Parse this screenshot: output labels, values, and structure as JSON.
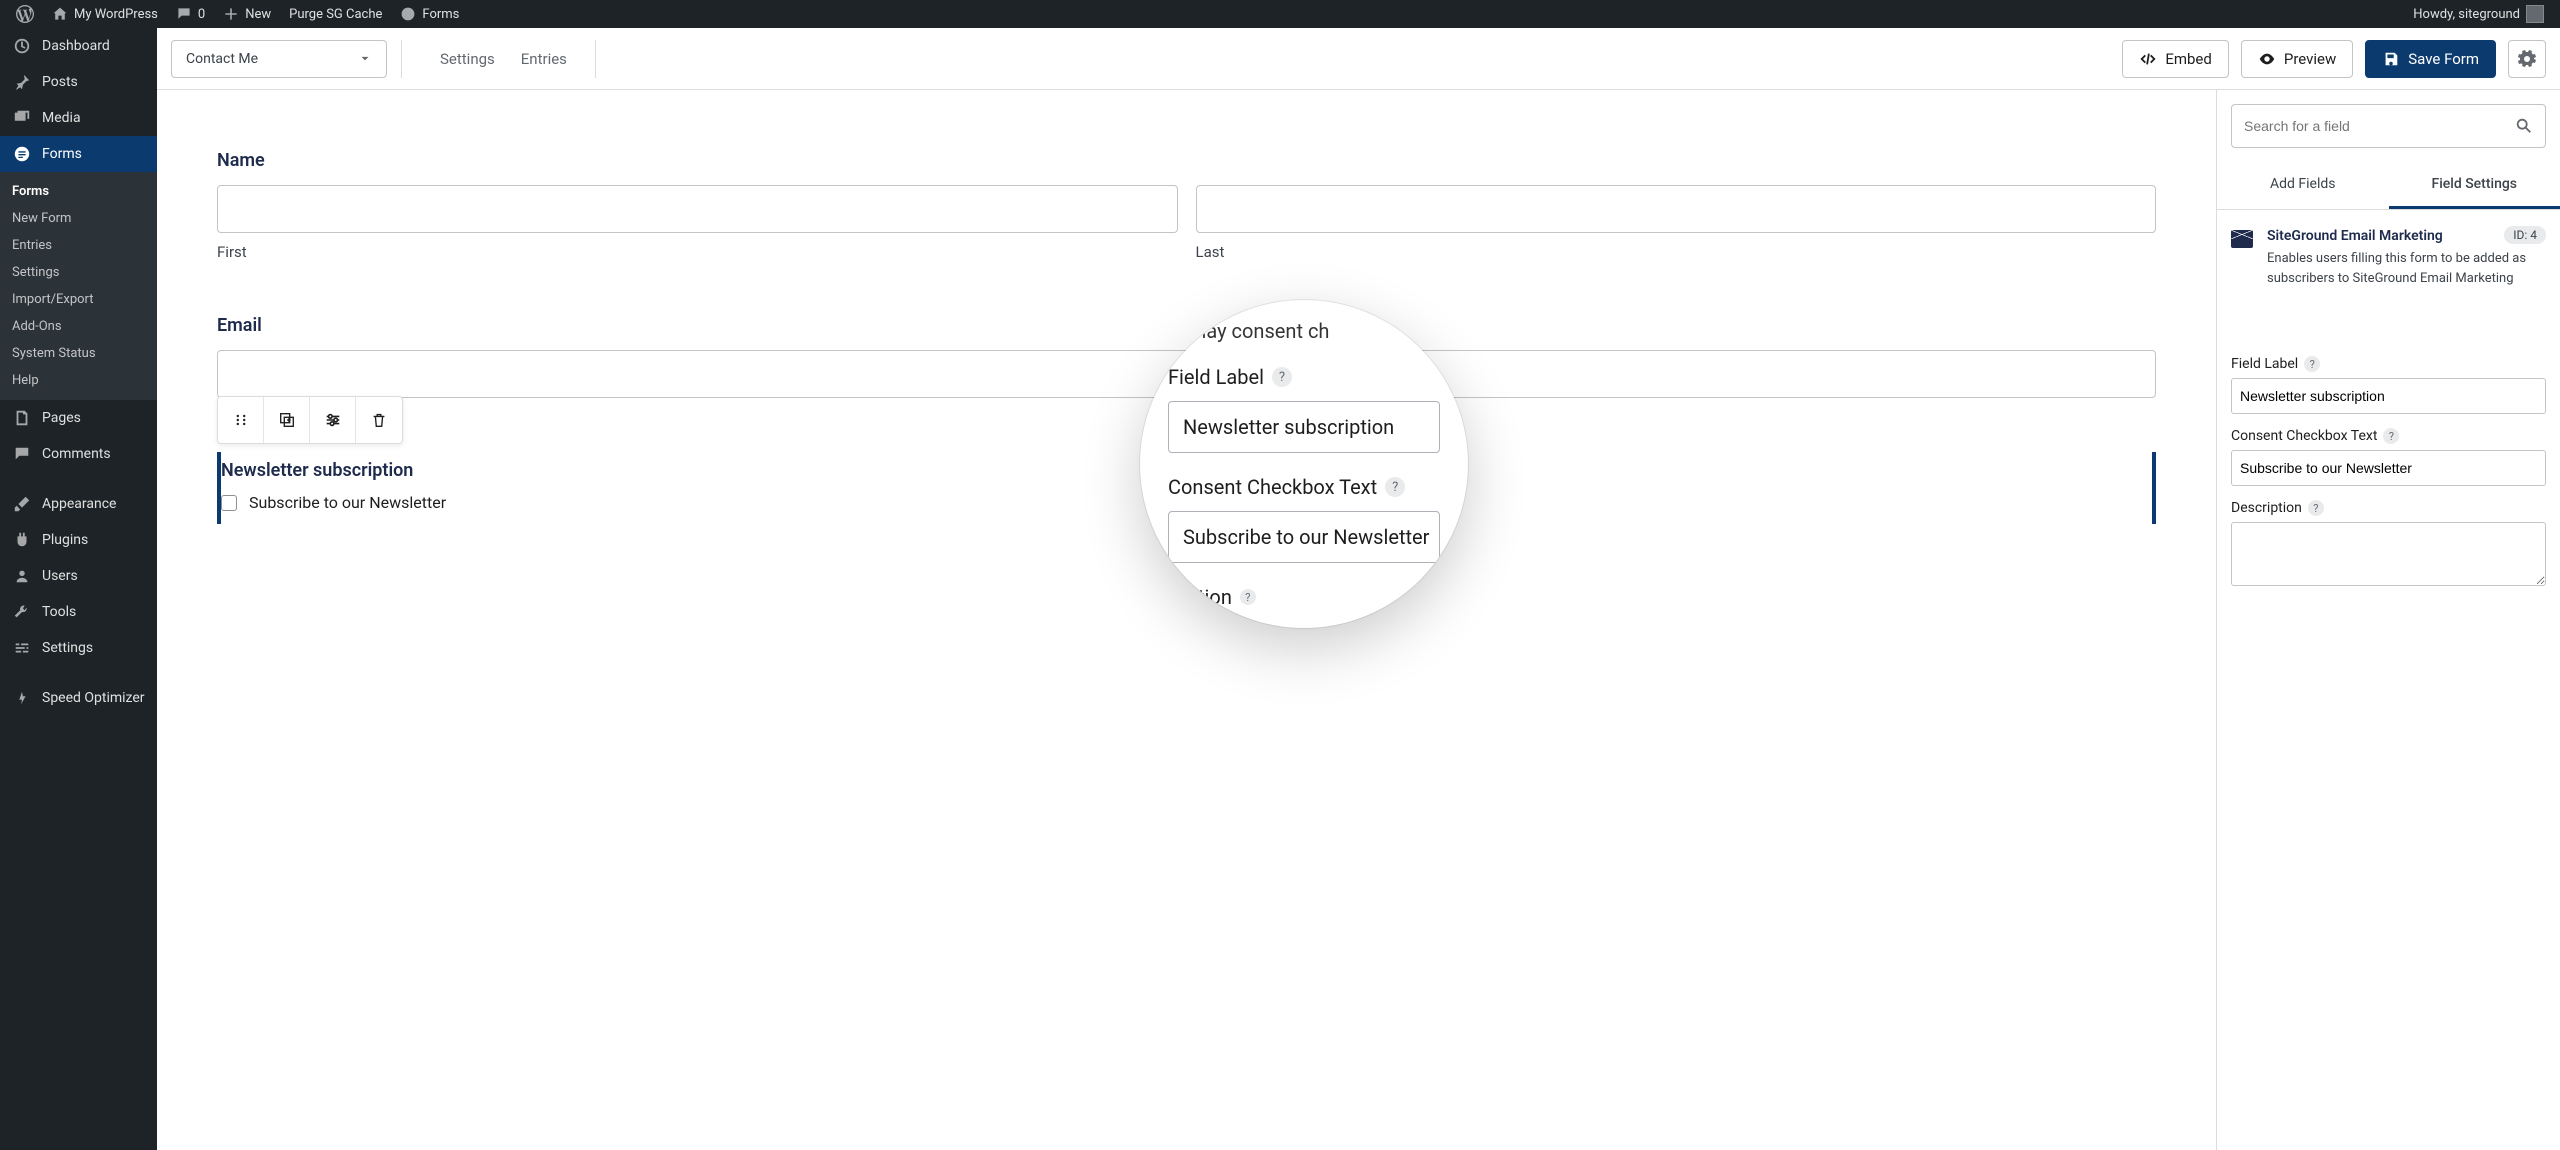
{
  "adminbar": {
    "site_name": "My WordPress",
    "comment_count": "0",
    "new": "New",
    "purge": "Purge SG Cache",
    "forms": "Forms",
    "howdy": "Howdy, siteground"
  },
  "sidebar": {
    "items": [
      {
        "label": "Dashboard",
        "icon": "dash"
      },
      {
        "label": "Posts",
        "icon": "pin"
      },
      {
        "label": "Media",
        "icon": "media"
      },
      {
        "label": "Forms",
        "icon": "forms",
        "active": true
      },
      {
        "label": "Pages",
        "icon": "pages"
      },
      {
        "label": "Comments",
        "icon": "comments"
      },
      {
        "label": "Appearance",
        "icon": "brush"
      },
      {
        "label": "Plugins",
        "icon": "plug"
      },
      {
        "label": "Users",
        "icon": "user"
      },
      {
        "label": "Tools",
        "icon": "wrench"
      },
      {
        "label": "Settings",
        "icon": "sliders"
      },
      {
        "label": "Speed Optimizer",
        "icon": "speed"
      }
    ],
    "submenu": [
      "Forms",
      "New Form",
      "Entries",
      "Settings",
      "Import/Export",
      "Add-Ons",
      "System Status",
      "Help"
    ]
  },
  "topbar": {
    "form_name": "Contact Me",
    "tabs": [
      "Settings",
      "Entries"
    ],
    "embed": "Embed",
    "preview": "Preview",
    "save": "Save Form"
  },
  "canvas": {
    "name_label": "Name",
    "first": "First",
    "last": "Last",
    "email_label": "Email",
    "newsletter_label": "Newsletter subscription",
    "newsletter_cb": "Subscribe to our Newsletter"
  },
  "panel": {
    "search_placeholder": "Search for a field",
    "tabs": [
      "Add Fields",
      "Field Settings"
    ],
    "field_title": "SiteGround Email Marketing",
    "field_desc": "Enables users filling this form to be added as subscribers to SiteGround Email Marketing",
    "id_badge": "ID: 4",
    "settings": {
      "field_label": "Field Label",
      "field_label_val": "Newsletter subscription",
      "consent_label": "Consent Checkbox Text",
      "consent_val": "Subscribe to our Newsletter",
      "desc_label": "Description"
    }
  },
  "magnifier": {
    "top_fragment": "Display consent ch",
    "label1": "Field Label",
    "val1": "Newsletter subscription",
    "label2": "Consent Checkbox Text",
    "val2": "Subscribe to our Newsletter",
    "bot_fragment": "tion"
  }
}
